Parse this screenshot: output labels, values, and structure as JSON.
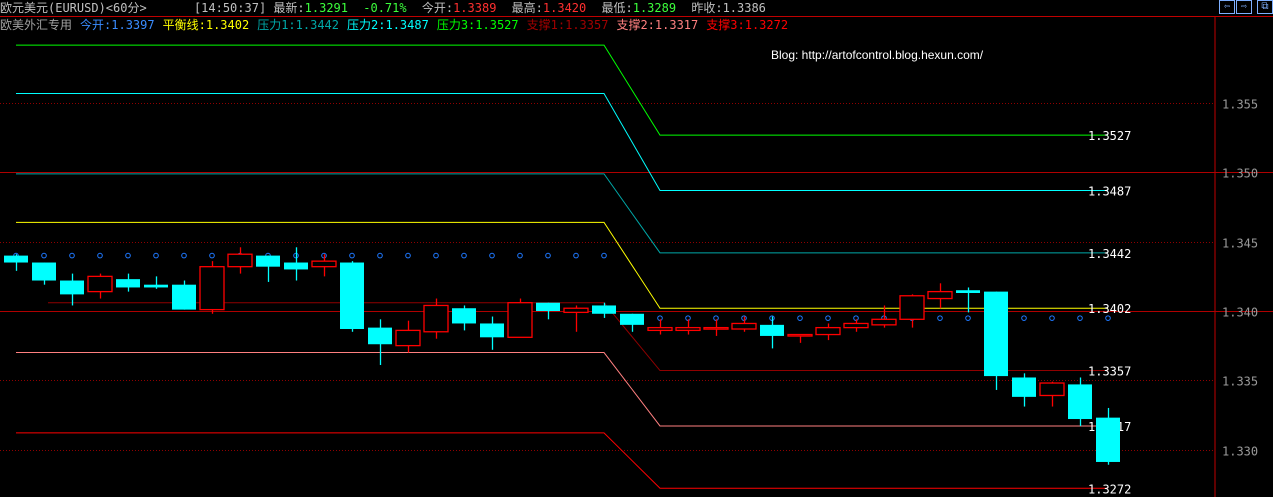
{
  "header": {
    "symbol": "欧元美元(EURUSD)<60分>",
    "time": "[14:50:37]",
    "latest_label": "最新:",
    "latest": "1.3291",
    "change": "-0.71%",
    "open_label": "今开:",
    "open": "1.3389",
    "high_label": "最高:",
    "high": "1.3420",
    "low_label": "最低:",
    "low": "1.3289",
    "prev_close_label": "昨收:",
    "prev_close": "1.3386"
  },
  "indicator": {
    "name": "欧美外汇专用",
    "items": [
      {
        "label": "今开:",
        "value": "1.3397",
        "color": "#3a8cff"
      },
      {
        "label": "平衡线:",
        "value": "1.3402",
        "color": "#ffff00"
      },
      {
        "label": "压力1:",
        "value": "1.3442",
        "color": "#00a8a8"
      },
      {
        "label": "压力2:",
        "value": "1.3487",
        "color": "#00ffff"
      },
      {
        "label": "压力3:",
        "value": "1.3527",
        "color": "#00ff00"
      },
      {
        "label": "支撑1:",
        "value": "1.3357",
        "color": "#a00000"
      },
      {
        "label": "支撑2:",
        "value": "1.3317",
        "color": "#ff8080"
      },
      {
        "label": "支撑3:",
        "value": "1.3272",
        "color": "#ff0000"
      }
    ]
  },
  "nav": {
    "left": "⇦",
    "right": "⇨",
    "restore": "⧉"
  },
  "blog": "Blog: http://artofcontrol.blog.hexun.com/",
  "chart_data": {
    "type": "candlestick",
    "ylim": [
      1.3266,
      1.3601
    ],
    "y_ticks": [
      "1.355",
      "1.350",
      "1.345",
      "1.340",
      "1.335",
      "1.330"
    ],
    "grid": true,
    "colors": {
      "up": "#ff0000",
      "down": "#00ffff",
      "open_marker": "#1e78ff"
    },
    "candles": [
      [
        1.344,
        1.3441,
        1.3429,
        1.3435
      ],
      [
        1.3435,
        1.3435,
        1.3419,
        1.3422
      ],
      [
        1.3422,
        1.3427,
        1.3404,
        1.3412
      ],
      [
        1.3414,
        1.3427,
        1.3409,
        1.3425
      ],
      [
        1.3423,
        1.3427,
        1.3414,
        1.3417
      ],
      [
        1.3419,
        1.3425,
        1.3416,
        1.3417
      ],
      [
        1.3419,
        1.3422,
        1.3401,
        1.3401
      ],
      [
        1.3401,
        1.3436,
        1.3398,
        1.3432
      ],
      [
        1.3432,
        1.3446,
        1.3427,
        1.3441
      ],
      [
        1.344,
        1.344,
        1.3421,
        1.3432
      ],
      [
        1.3435,
        1.3446,
        1.3422,
        1.343
      ],
      [
        1.3432,
        1.3441,
        1.3425,
        1.3436
      ],
      [
        1.3435,
        1.3436,
        1.3385,
        1.3387
      ],
      [
        1.3388,
        1.3394,
        1.3361,
        1.3376
      ],
      [
        1.3375,
        1.3393,
        1.337,
        1.3386
      ],
      [
        1.3385,
        1.3409,
        1.338,
        1.3404
      ],
      [
        1.3402,
        1.3404,
        1.3386,
        1.3391
      ],
      [
        1.3391,
        1.3396,
        1.3372,
        1.3381
      ],
      [
        1.3381,
        1.3409,
        1.3381,
        1.3406
      ],
      [
        1.3406,
        1.3406,
        1.3394,
        1.34
      ],
      [
        1.3399,
        1.3404,
        1.3385,
        1.3402
      ],
      [
        1.3404,
        1.3406,
        1.3395,
        1.3398
      ],
      [
        1.3398,
        1.3398,
        1.3385,
        1.339
      ],
      [
        1.3386,
        1.3394,
        1.3383,
        1.3388
      ],
      [
        1.3386,
        1.3394,
        1.3383,
        1.3388
      ],
      [
        1.3387,
        1.3394,
        1.3382,
        1.3388
      ],
      [
        1.3387,
        1.3396,
        1.3385,
        1.3391
      ],
      [
        1.339,
        1.3396,
        1.3373,
        1.3382
      ],
      [
        1.3382,
        1.3383,
        1.3377,
        1.3383
      ],
      [
        1.3383,
        1.3391,
        1.3379,
        1.3388
      ],
      [
        1.3388,
        1.3394,
        1.3385,
        1.3391
      ],
      [
        1.339,
        1.3404,
        1.3388,
        1.3394
      ],
      [
        1.3394,
        1.3412,
        1.3388,
        1.3411
      ],
      [
        1.3409,
        1.342,
        1.3402,
        1.3414
      ],
      [
        1.3415,
        1.3417,
        1.3399,
        1.3413
      ],
      [
        1.3414,
        1.3414,
        1.3343,
        1.3353
      ],
      [
        1.3352,
        1.3355,
        1.3331,
        1.3338
      ],
      [
        1.3339,
        1.3349,
        1.3331,
        1.3348
      ],
      [
        1.3347,
        1.3352,
        1.3317,
        1.3322
      ],
      [
        1.3323,
        1.333,
        1.3289,
        1.3291
      ]
    ],
    "open_marker": {
      "previous": 1.344,
      "current": 1.3397
    },
    "levels": [
      {
        "name": "压力3",
        "previous": 1.3592,
        "current": 1.3527,
        "color": "#00ff00",
        "label": "1.3527"
      },
      {
        "name": "压力2",
        "previous": 1.3557,
        "current": 1.3487,
        "color": "#00ffff",
        "label": "1.3487"
      },
      {
        "name": "压力1",
        "previous": 1.3499,
        "current": 1.3442,
        "color": "#00a8a8",
        "label": "1.3442"
      },
      {
        "name": "平衡线",
        "previous": 1.3464,
        "current": 1.3402,
        "color": "#ffff00",
        "label": "1.3402"
      },
      {
        "name": "支撑1",
        "previous": 1.3406,
        "current": 1.3357,
        "color": "#900000",
        "label": "1.3357"
      },
      {
        "name": "支撑2",
        "previous": 1.337,
        "current": 1.3317,
        "color": "#ff8080",
        "label": "1.3317"
      },
      {
        "name": "支撑3",
        "previous": 1.3312,
        "current": 1.3272,
        "color": "#ff0000",
        "label": "1.3272"
      }
    ]
  }
}
